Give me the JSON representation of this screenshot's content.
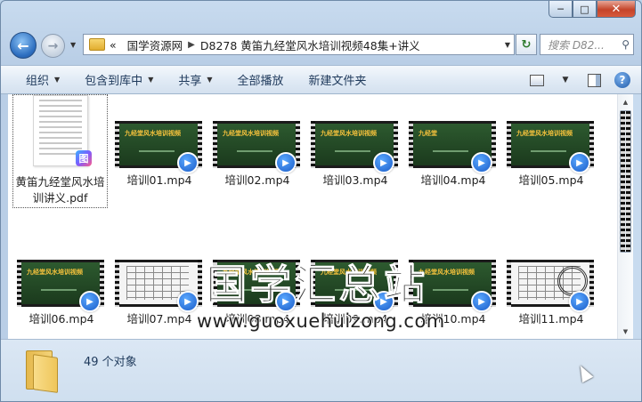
{
  "window": {
    "caption_buttons": {
      "minimize": "─",
      "maximize": "□",
      "close": "✕"
    }
  },
  "nav": {
    "back_icon": "back-arrow-icon",
    "forward_icon": "forward-arrow-icon",
    "breadcrumb": [
      "«",
      "国学资源网",
      "D8278 黄笛九经堂风水培训视频48集+讲义"
    ],
    "search_placeholder": "搜索 D82...",
    "refresh_glyph": "↻"
  },
  "toolbar": {
    "items": [
      "组织",
      "包含到库中",
      "共享",
      "全部播放",
      "新建文件夹"
    ],
    "help_glyph": "?"
  },
  "files": {
    "pdf": {
      "name": "黄笛九经堂风水培训讲义.pdf",
      "badge": "图"
    },
    "videos": [
      {
        "name": "培训01.mp4",
        "frame_title": "九经堂风水培训视频",
        "style": "green"
      },
      {
        "name": "培训02.mp4",
        "frame_title": "九经堂风水培训视频",
        "style": "green"
      },
      {
        "name": "培训03.mp4",
        "frame_title": "九经堂风水培训视频",
        "style": "green"
      },
      {
        "name": "培训04.mp4",
        "frame_title": "九经堂",
        "style": "green"
      },
      {
        "name": "培训05.mp4",
        "frame_title": "九经堂风水培训视频",
        "style": "green"
      },
      {
        "name": "培训06.mp4",
        "frame_title": "九经堂风水培训视频",
        "style": "green"
      },
      {
        "name": "培训07.mp4",
        "frame_title": "",
        "style": "white"
      },
      {
        "name": "培训08.mp4",
        "frame_title": "九经堂风水培训视频",
        "style": "green"
      },
      {
        "name": "培训09.mp4",
        "frame_title": "九经堂风水培训视频",
        "style": "green"
      },
      {
        "name": "培训10.mp4",
        "frame_title": "九经堂风水培训视频",
        "style": "green"
      },
      {
        "name": "培训11.mp4",
        "frame_title": "",
        "style": "white-wheel"
      }
    ]
  },
  "watermark": {
    "title": "国学汇总站",
    "url": "www.guoxuehuizong.com"
  },
  "status": {
    "count": "49 个对象"
  },
  "colors": {
    "toolbar_text": "#1e395b",
    "window_frame": "#bcd3ea",
    "accent": "#2e6fc0"
  }
}
